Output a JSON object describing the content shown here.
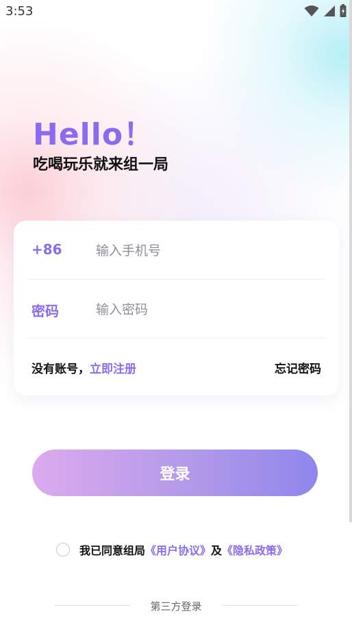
{
  "status_bar": {
    "time": "3:53"
  },
  "greeting": {
    "hello": "Hello！",
    "slogan": "吃喝玩乐就来组一局"
  },
  "form": {
    "phone": {
      "prefix": "+86",
      "placeholder": "输入手机号",
      "value": ""
    },
    "password": {
      "label": "密码",
      "placeholder": "输入密码",
      "value": ""
    },
    "no_account_text": "没有账号，",
    "register_link": "立即注册",
    "forgot_password": "忘记密码"
  },
  "login_button": "登录",
  "agreement": {
    "checked": false,
    "prefix": "我已同意组局",
    "user_agreement": "《用户协议》",
    "and": "及",
    "privacy_policy": "《隐私政策》"
  },
  "third_party": {
    "label": "第三方登录"
  },
  "colors": {
    "accent": "#8b6cf0",
    "button_start": "#dcaaee",
    "button_end": "#8f86ed"
  }
}
